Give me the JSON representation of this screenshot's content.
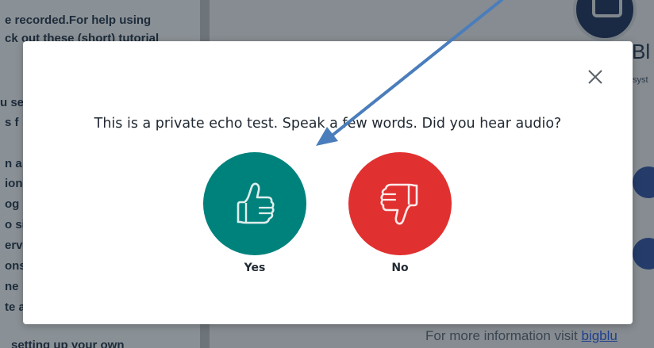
{
  "background": {
    "sidebar_lines": [
      "e recorded.For help using",
      "ck out these (short) tutorial",
      "u se",
      "s f",
      "n a",
      "ion",
      "og",
      "o si",
      "erv",
      "ons",
      "ne",
      "te a",
      "setting up your own"
    ],
    "brand_fragment": "Bl",
    "side_fragment": "syst",
    "footer_text": "For more information visit ",
    "footer_link": "bigblu"
  },
  "modal": {
    "question": "This is a private echo test. Speak a few words. Did you hear audio?",
    "yes_label": "Yes",
    "no_label": "No",
    "colors": {
      "yes": "#00827c",
      "no": "#e13030",
      "arrow": "#4a7dbb"
    },
    "icons": {
      "close": "close-icon",
      "yes": "thumbs-up-icon",
      "no": "thumbs-down-icon"
    }
  }
}
